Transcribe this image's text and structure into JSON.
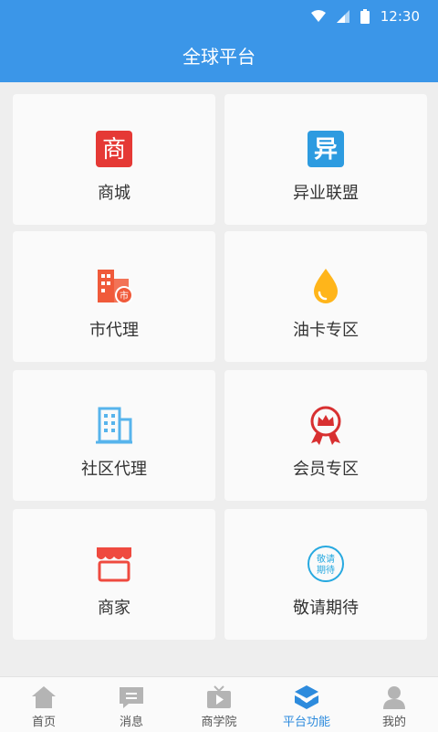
{
  "status": {
    "time": "12:30"
  },
  "header": {
    "title": "全球平台"
  },
  "grid": [
    {
      "name": "mall",
      "label": "商城",
      "icon": "shop-char-icon",
      "color": "#e53935"
    },
    {
      "name": "cross-industry-alliance",
      "label": "异业联盟",
      "icon": "alliance-icon",
      "color": "#2d9be0"
    },
    {
      "name": "city-agent",
      "label": "市代理",
      "icon": "city-building-icon",
      "color": "#f05a3a"
    },
    {
      "name": "fuel-card",
      "label": "油卡专区",
      "icon": "oil-drop-icon",
      "color": "#ffb51a"
    },
    {
      "name": "community-agent",
      "label": "社区代理",
      "icon": "building-icon",
      "color": "#57b4ec"
    },
    {
      "name": "member-zone",
      "label": "会员专区",
      "icon": "crown-badge-icon",
      "color": "#d83031"
    },
    {
      "name": "merchant",
      "label": "商家",
      "icon": "store-awning-icon",
      "color": "#ef4a3f"
    },
    {
      "name": "coming-soon",
      "label": "敬请期待",
      "icon": "coming-soon-icon",
      "color": "#27a9e0",
      "icon_text": [
        "敬请",
        "期待"
      ]
    }
  ],
  "tabs": [
    {
      "label": "首页",
      "icon": "home-icon",
      "active": false
    },
    {
      "label": "消息",
      "icon": "message-icon",
      "active": false
    },
    {
      "label": "商学院",
      "icon": "video-icon",
      "active": false
    },
    {
      "label": "平台功能",
      "icon": "platform-icon",
      "active": true
    },
    {
      "label": "我的",
      "icon": "user-icon",
      "active": false
    }
  ]
}
